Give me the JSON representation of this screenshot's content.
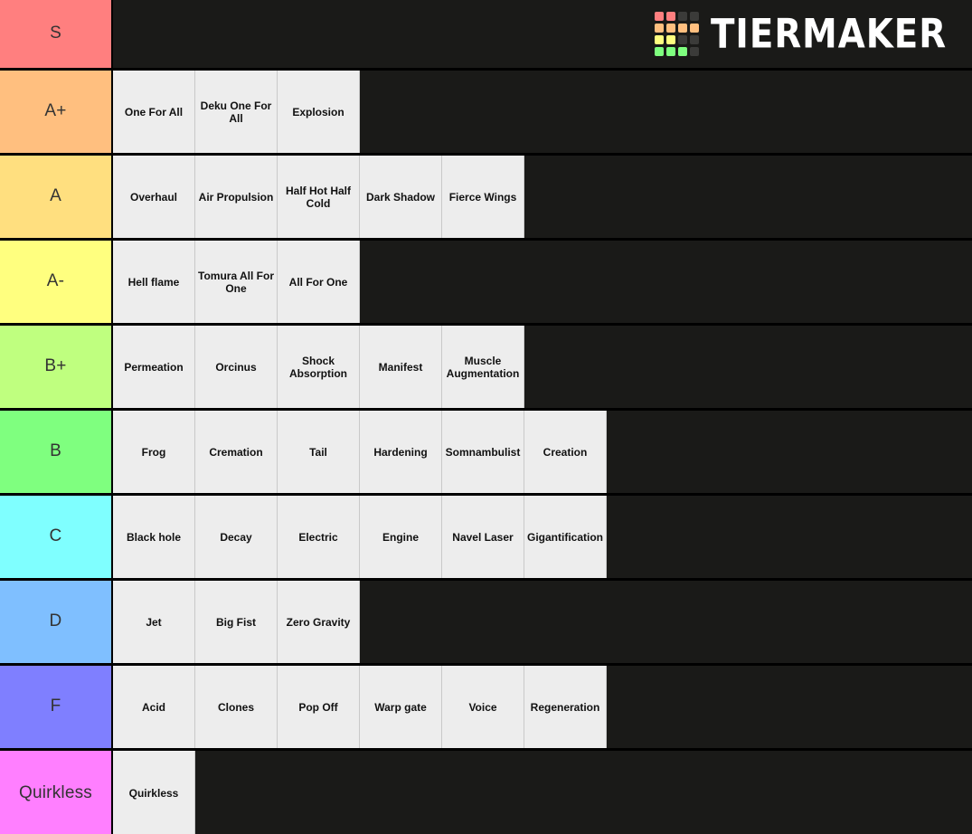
{
  "app": {
    "logo_text": "TIERMAKER",
    "logo_name": "tiermaker-logo"
  },
  "logo_grid": {
    "cells": [
      "#ff7f7f",
      "#ff7f7f",
      "#3b3b39",
      "#3b3b39",
      "#ffbf7f",
      "#ffbf7f",
      "#ffbf7f",
      "#ffbf7f",
      "#ffff7f",
      "#ffff7f",
      "#3b3b39",
      "#3b3b39",
      "#7fff7f",
      "#7fff7f",
      "#7fff7f",
      "#3b3b39"
    ]
  },
  "colors": {
    "background": "#1a1a18",
    "item_background": "#ededed",
    "item_text": "#111111",
    "label_text": "#333333",
    "border": "#000000"
  },
  "tiers": [
    {
      "label": "S",
      "color": "#ff7f7f",
      "items": []
    },
    {
      "label": "A+",
      "color": "#ffbf7f",
      "items": [
        "One For All",
        "Deku One For All",
        "Explosion"
      ]
    },
    {
      "label": "A",
      "color": "#ffdf7f",
      "items": [
        "Overhaul",
        "Air Propulsion",
        "Half Hot Half Cold",
        "Dark Shadow",
        "Fierce Wings"
      ]
    },
    {
      "label": "A-",
      "color": "#ffff7f",
      "items": [
        "Hell flame",
        "Tomura All For One",
        "All For One"
      ]
    },
    {
      "label": "B+",
      "color": "#bfff7f",
      "items": [
        "Permeation",
        "Orcinus",
        "Shock Absorption",
        "Manifest",
        "Muscle Augmentation"
      ]
    },
    {
      "label": "B",
      "color": "#7fff7f",
      "items": [
        "Frog",
        "Cremation",
        "Tail",
        "Hardening",
        "Somnambulist",
        "Creation"
      ]
    },
    {
      "label": "C",
      "color": "#7fffff",
      "items": [
        "Black hole",
        "Decay",
        "Electric",
        "Engine",
        "Navel Laser",
        "Gigantification"
      ]
    },
    {
      "label": "D",
      "color": "#7fbfff",
      "items": [
        "Jet",
        "Big Fist",
        "Zero Gravity"
      ]
    },
    {
      "label": "F",
      "color": "#7f7fff",
      "items": [
        "Acid",
        "Clones",
        "Pop Off",
        "Warp gate",
        "Voice",
        "Regeneration"
      ]
    },
    {
      "label": "Quirkless",
      "color": "#ff7fff",
      "items": [
        "Quirkless"
      ]
    }
  ]
}
